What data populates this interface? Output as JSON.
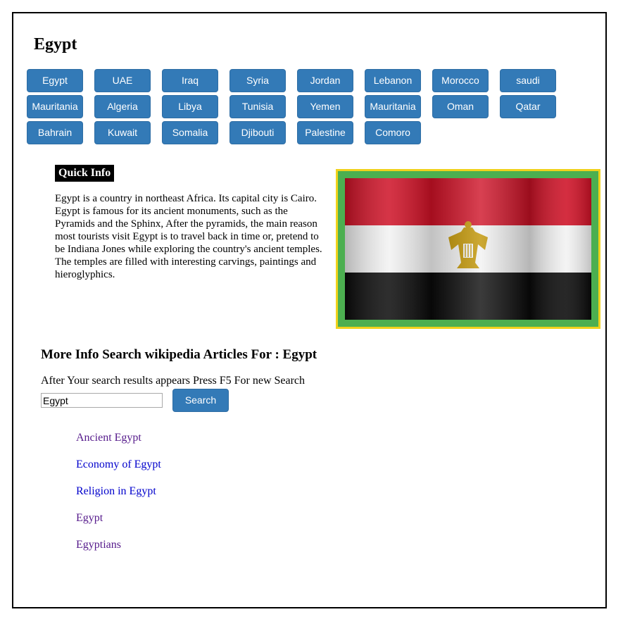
{
  "page": {
    "title": "Egypt"
  },
  "countries": [
    "Egypt",
    "UAE",
    "Iraq",
    "Syria",
    "Jordan",
    "Lebanon",
    "Morocco",
    "saudi",
    "Mauritania",
    "Algeria",
    "Libya",
    "Tunisia",
    "Yemen",
    "Mauritania",
    "Oman",
    "Qatar",
    "Bahrain",
    "Kuwait",
    "Somalia",
    "Djibouti",
    "Palestine",
    "Comoro"
  ],
  "quick_info": {
    "heading": "Quick Info",
    "text": "Egypt is a country in northeast Africa. Its capital city is Cairo. Egypt is famous for its ancient monuments, such as the Pyramids and the Sphinx, After the pyramids, the main reason most tourists visit Egypt is to travel back in time or, pretend to be Indiana Jones while exploring the country's ancient temples. The temples are filled with interesting carvings, paintings and hieroglyphics."
  },
  "flag": {
    "icon": "egypt-flag",
    "colors": {
      "red": "#ce1126",
      "white": "#ffffff",
      "black": "#000000",
      "eagle": "#c09300",
      "frame_border": "#f0d21c",
      "frame_fill": "#4caf50"
    }
  },
  "search": {
    "heading": "More Info Search wikipedia Articles For : Egypt",
    "hint": "After Your search results appears Press F5 For new Search",
    "input_value": "Egypt",
    "button_label": "Search"
  },
  "results": [
    {
      "label": "Ancient Egypt",
      "visited": true
    },
    {
      "label": "Economy of Egypt",
      "visited": false
    },
    {
      "label": "Religion in Egypt",
      "visited": false
    },
    {
      "label": "Egypt",
      "visited": true
    },
    {
      "label": "Egyptians",
      "visited": true
    }
  ],
  "colors": {
    "button": "#337ab7",
    "link_visited": "#551a8b",
    "link_unvisited": "#0000cc"
  }
}
